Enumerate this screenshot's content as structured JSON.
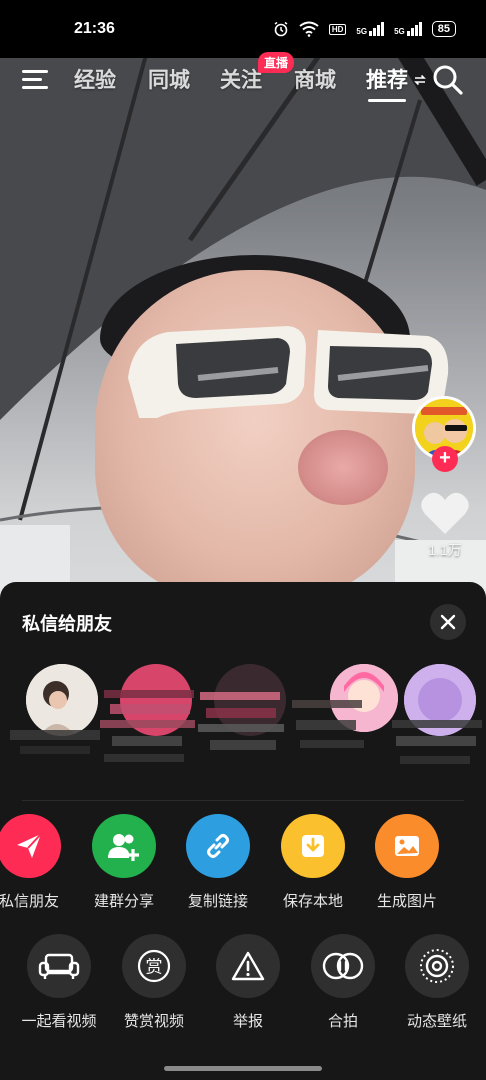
{
  "status_bar": {
    "time": "21:36",
    "network_tag": "HD",
    "signal_1_label": "5G",
    "signal_2_label": "5G",
    "battery": "85",
    "icons": [
      "alarm-icon",
      "wifi-icon",
      "signal-icon",
      "signal-icon",
      "battery-icon"
    ]
  },
  "top_nav": {
    "tabs": [
      {
        "label": "经验"
      },
      {
        "label": "同城"
      },
      {
        "label": "关注"
      },
      {
        "label": "商城"
      },
      {
        "label": "推荐"
      }
    ],
    "live_badge": "直播",
    "active_tab": "推荐"
  },
  "video": {
    "like_count": "1.1万",
    "follow_plus": "+"
  },
  "share_sheet": {
    "title": "私信给朋友",
    "friends_count_visible": 5,
    "share_actions": [
      {
        "label": "私信朋友",
        "color": "#fe2c55",
        "icon": "send-icon"
      },
      {
        "label": "建群分享",
        "color": "#22b14c",
        "icon": "group-add-icon"
      },
      {
        "label": "复制链接",
        "color": "#2d9fe0",
        "icon": "link-icon"
      },
      {
        "label": "保存本地",
        "color": "#fbc02d",
        "icon": "download-icon"
      },
      {
        "label": "生成图片",
        "color": "#fa8c2c",
        "icon": "image-icon"
      }
    ],
    "more_actions": [
      {
        "label": "一起看视频",
        "icon": "sofa-icon"
      },
      {
        "label": "赞赏视频",
        "icon": "reward-icon",
        "glyph": "赏"
      },
      {
        "label": "举报",
        "icon": "warning-icon"
      },
      {
        "label": "合拍",
        "icon": "duet-icon"
      },
      {
        "label": "动态壁纸",
        "icon": "live-wallpaper-icon"
      }
    ]
  },
  "colors": {
    "accent": "#fe2c55",
    "sheet_bg": "#171717",
    "button_bg": "#2f2f2f"
  }
}
